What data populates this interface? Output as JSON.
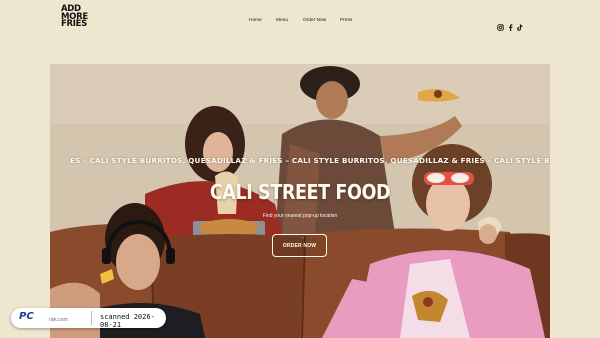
{
  "site": {
    "logo_lines": [
      "ADD",
      "MORE",
      "FRIES"
    ]
  },
  "nav": {
    "items": [
      {
        "label": "Home"
      },
      {
        "label": "Menu"
      },
      {
        "label": "Order Now"
      },
      {
        "label": "Press"
      }
    ]
  },
  "social": {
    "icons": [
      "instagram-icon",
      "facebook-icon",
      "tiktok-icon"
    ]
  },
  "hero": {
    "marquee": "ES – CALI STYLE BURRITOS, QUESADILLAZ & FRIES – CALI STYLE BURRITOS, QUESADILLAZ & FRIES – CALI STYLE BURRITOS, QUESADILLAZ & FRIES –",
    "title": "CALI STREET FOOD",
    "subtitle": "Find your nearest pop-up location",
    "cta_label": "ORDER NOW"
  },
  "overlay": {
    "brand": "PC",
    "brand_suffix": "risk.com",
    "stamp": "scanned 2026-08-21"
  },
  "colors": {
    "page_bg": "#efe6cf",
    "text": "#1a1410",
    "hero_text": "#fffaf0",
    "sofa": "#8a4a2c"
  }
}
